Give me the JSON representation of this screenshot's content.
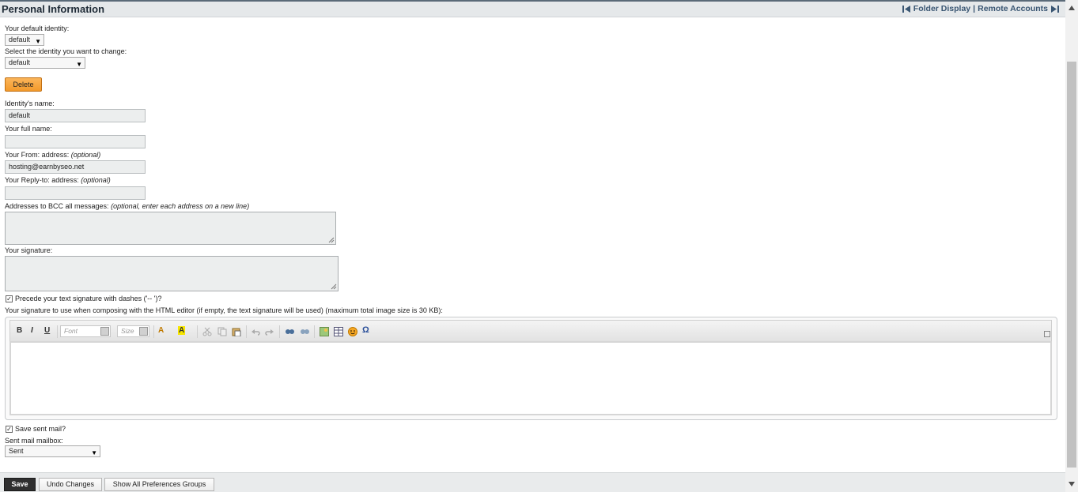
{
  "header": {
    "title": "Personal Information",
    "folder_display": "Folder Display",
    "separator": "|",
    "remote_accounts": "Remote Accounts"
  },
  "form": {
    "default_identity_label": "Your default identity:",
    "default_identity_value": "default",
    "select_identity_label": "Select the identity you want to change:",
    "select_identity_value": "default",
    "delete_label": "Delete",
    "identity_name_label": "Identity's name:",
    "identity_name_value": "default",
    "full_name_label": "Your full name:",
    "full_name_value": "",
    "from_label": "Your From: address:",
    "from_optional": "(optional)",
    "from_value": "hosting@earnbyseo.net",
    "reply_to_label": "Your Reply-to: address:",
    "reply_to_optional": "(optional)",
    "reply_to_value": "",
    "bcc_label": "Addresses to BCC all messages:",
    "bcc_optional": "(optional, enter each address on a new line)",
    "signature_label": "Your signature:",
    "precede_dashes_label": "Precede your text signature with dashes ('-- ')?",
    "precede_dashes_checked": true,
    "html_signature_label": "Your signature to use when composing with the HTML editor (if empty, the text signature will be used) (maximum total image size is 30 KB):",
    "save_sent_label": "Save sent mail?",
    "save_sent_checked": true,
    "sent_mailbox_label": "Sent mail mailbox:",
    "sent_mailbox_value": "Sent"
  },
  "editor": {
    "bold": "B",
    "italic": "I",
    "underline": "U",
    "font_placeholder": "Font",
    "size_placeholder": "Size",
    "text_color": "A",
    "bg_color": "A",
    "special_char": "Ω"
  },
  "footer": {
    "save": "Save",
    "undo": "Undo Changes",
    "show_all": "Show All Preferences Groups"
  },
  "colors": {
    "accent_orange": "#f39a2b",
    "header_link": "#3a5673",
    "header_bg": "#e5e8ea"
  }
}
